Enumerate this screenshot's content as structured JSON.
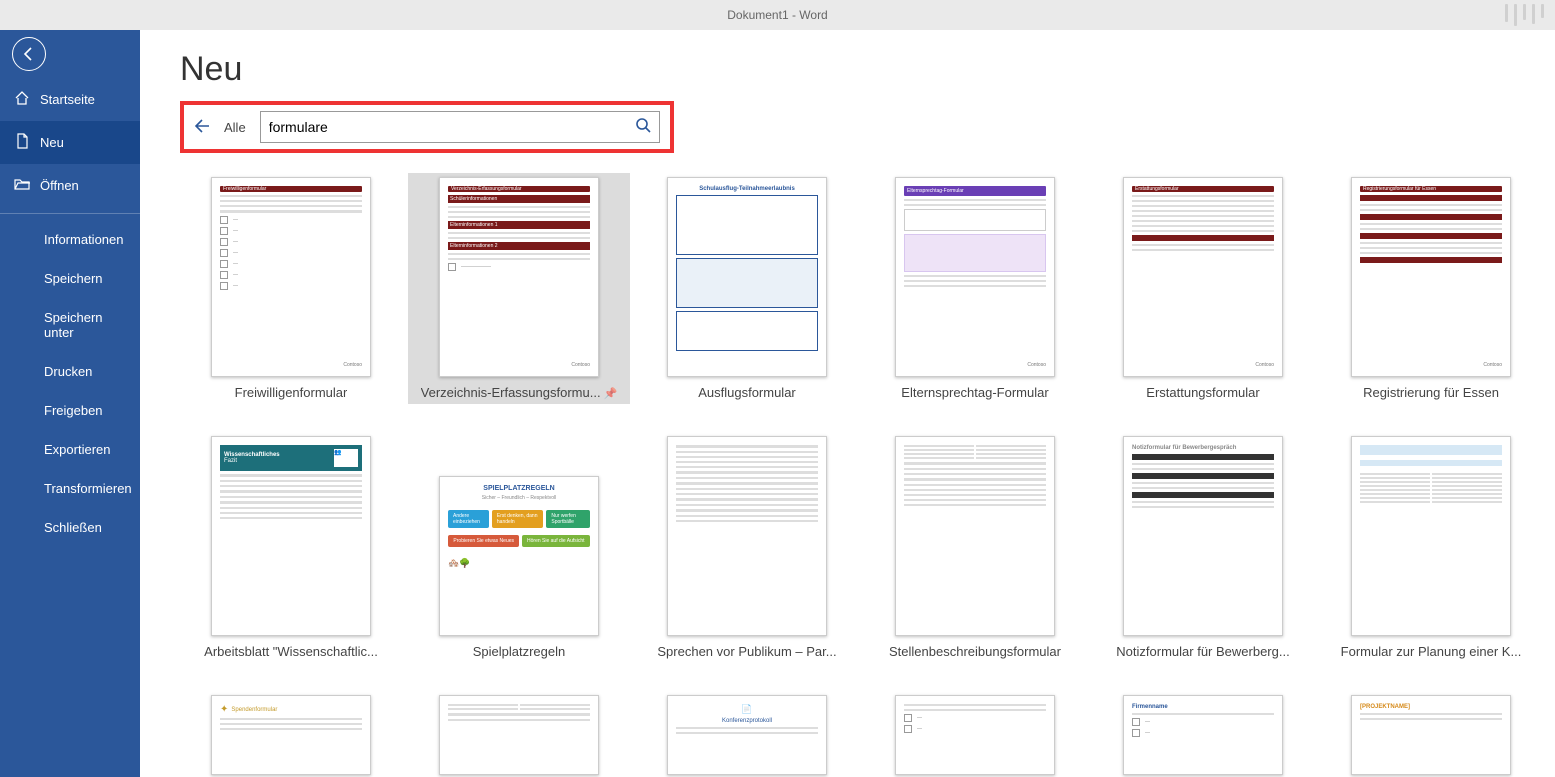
{
  "titlebar": {
    "label": "Dokument1  -  Word"
  },
  "sidebar": {
    "home": "Startseite",
    "new": "Neu",
    "open": "Öffnen",
    "items": [
      "Informationen",
      "Speichern",
      "Speichern unter",
      "Drucken",
      "Freigeben",
      "Exportieren",
      "Transformieren",
      "Schließen"
    ]
  },
  "page": {
    "title": "Neu"
  },
  "search": {
    "category": "Alle",
    "value": "formulare"
  },
  "templates_row1": [
    {
      "label": "Freiwilligenformular"
    },
    {
      "label": "Verzeichnis-Erfassungsformu...",
      "selected": true
    },
    {
      "label": "Ausflugsformular"
    },
    {
      "label": "Elternsprechtag-Formular"
    },
    {
      "label": "Erstattungsformular"
    },
    {
      "label": "Registrierung für Essen"
    }
  ],
  "templates_row2": [
    {
      "label": "Arbeitsblatt \"Wissenschaftlic..."
    },
    {
      "label": "Spielplatzregeln"
    },
    {
      "label": "Sprechen vor Publikum – Par..."
    },
    {
      "label": "Stellenbeschreibungsformular"
    },
    {
      "label": "Notizformular für Bewerberg..."
    },
    {
      "label": "Formular zur Planung einer K..."
    }
  ],
  "thumb_text": {
    "t0_header": "Freiwilligenformular",
    "t1_header": "Verzeichnis-Erfassungsformular",
    "t2_header": "Schulausflug-Teilnahmeerlaubnis",
    "t3_header": "Elternsprechtag-Formular",
    "t4_header": "Erstattungsformular",
    "t5_header": "Registrierungsformular für Essen",
    "t6_title": "Wissenschaftliches",
    "t6_sub": "Fazit",
    "t7_title": "SPIELPLATZREGELN",
    "t7_sub": "Sicher – Freundlich – Respektvoll",
    "t7_b1": "Andere einbeziehen",
    "t7_b2": "Erst denken, dann handeln",
    "t7_b3": "Nur werfen Sportbälle",
    "t7_b4": "Probieren Sie etwas Neues",
    "t7_b5": "Hören Sie auf die Aufsicht",
    "t10_header": "Notizformular für Bewerbergespräch",
    "contoso": "Contoso",
    "konf": "Konferenzprotokoll",
    "firma": "Firmenname",
    "proj": "[PROJEKTNAME]",
    "spende": "Spendenformular"
  }
}
